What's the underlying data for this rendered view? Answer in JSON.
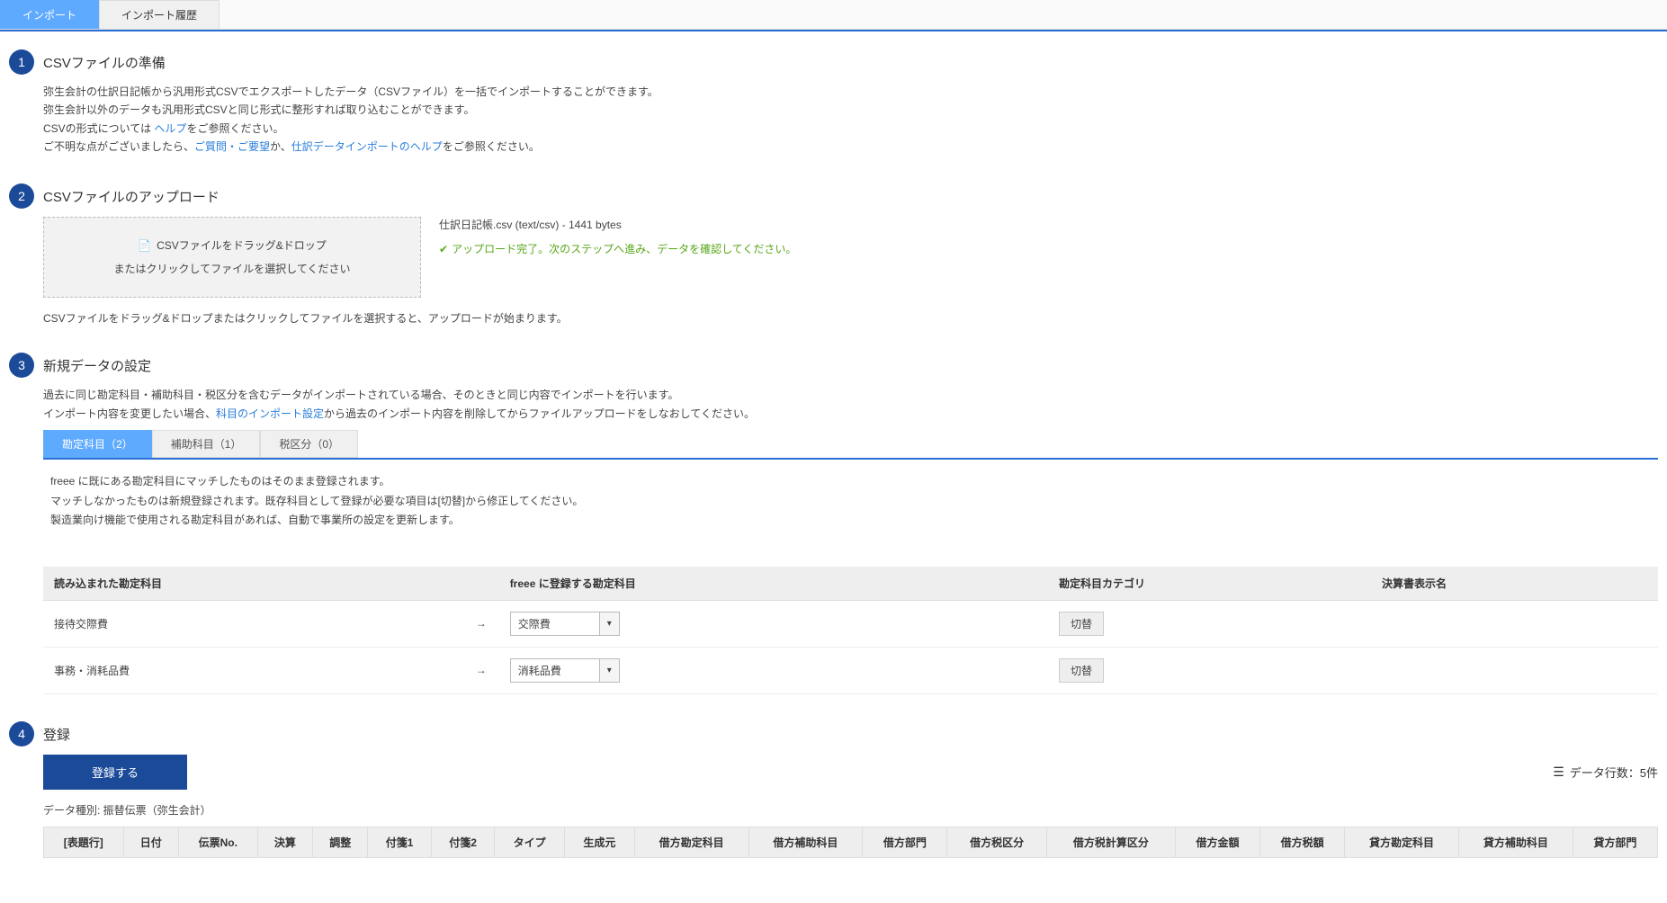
{
  "tabs": {
    "import": "インポート",
    "history": "インポート履歴"
  },
  "step1": {
    "num": "1",
    "title": "CSVファイルの準備",
    "line1a": "弥生会計の仕訳日記帳から汎用形式CSVでエクスポートしたデータ（CSVファイル）を一括でインポートすることができます。",
    "line1b": "弥生会計以外のデータも汎用形式CSVと同じ形式に整形すれば取り込むことができます。",
    "line2a": "CSVの形式については ",
    "help_link": "ヘルプ",
    "line2b": "をご参照ください。",
    "line3a": "ご不明な点がございましたら、",
    "inquiry_link": "ご質問・ご要望",
    "line3b": "か、",
    "import_help_link": "仕訳データインポートのヘルプ",
    "line3c": "をご参照ください。"
  },
  "step2": {
    "num": "2",
    "title": "CSVファイルのアップロード",
    "drop_line1": "CSVファイルをドラッグ&ドロップ",
    "drop_line2": "またはクリックしてファイルを選択してください",
    "file_info": "仕訳日記帳.csv (text/csv) - 1441 bytes",
    "success": "アップロード完了。次のステップへ進み、データを確認してください。",
    "note": "CSVファイルをドラッグ&ドロップまたはクリックしてファイルを選択すると、アップロードが始まります。"
  },
  "step3": {
    "num": "3",
    "title": "新規データの設定",
    "line1": "過去に同じ勘定科目・補助科目・税区分を含むデータがインポートされている場合、そのときと同じ内容でインポートを行います。",
    "line2a": "インポート内容を変更したい場合、",
    "settings_link": "科目のインポート設定",
    "line2b": "から過去のインポート内容を削除してからファイルアップロードをしなおしてください。",
    "pill_account": "勘定科目（2）",
    "pill_sub": "補助科目（1）",
    "pill_tax": "税区分（0）",
    "note1": "freee に既にある勘定科目にマッチしたものはそのまま登録されます。",
    "note2": "マッチしなかったものは新規登録されます。既存科目として登録が必要な項目は[切替]から修正してください。",
    "note3": "製造業向け機能で使用される勘定科目があれば、自動で事業所の設定を更新します。",
    "table": {
      "col_read": "読み込まれた勘定科目",
      "col_register": "freee に登録する勘定科目",
      "col_category": "勘定科目カテゴリ",
      "col_report": "決算書表示名",
      "rows": [
        {
          "read": "接待交際費",
          "register": "交際費",
          "swap": "切替"
        },
        {
          "read": "事務・消耗品費",
          "register": "消耗品費",
          "swap": "切替"
        }
      ]
    }
  },
  "step4": {
    "num": "4",
    "title": "登録",
    "register_btn": "登録する",
    "row_count": "データ行数：5件",
    "data_type_label": "データ種別: ",
    "data_type_value": "振替伝票（弥生会計）",
    "preview_headers": [
      "[表題行]",
      "日付",
      "伝票No.",
      "決算",
      "調整",
      "付箋1",
      "付箋2",
      "タイプ",
      "生成元",
      "借方勘定科目",
      "借方補助科目",
      "借方部門",
      "借方税区分",
      "借方税計算区分",
      "借方金額",
      "借方税額",
      "貸方勘定科目",
      "貸方補助科目",
      "貸方部門"
    ]
  }
}
